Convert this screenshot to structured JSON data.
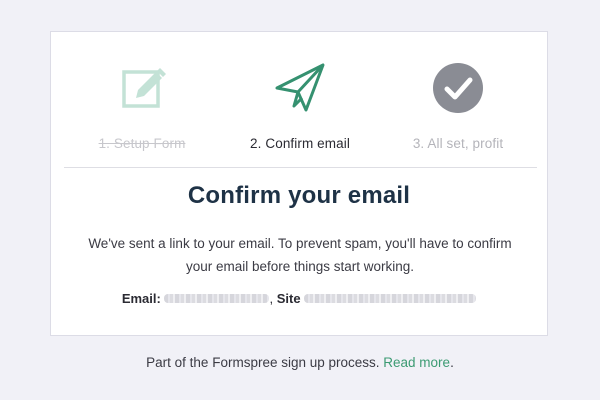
{
  "steps": [
    {
      "label": "1. Setup Form",
      "state": "completed",
      "icon": "edit-icon",
      "color": "#c3e2d6"
    },
    {
      "label": "2. Confirm email",
      "state": "active",
      "icon": "paper-plane-icon",
      "color": "#359170"
    },
    {
      "label": "3. All set, profit",
      "state": "pending",
      "icon": "checkmark-circle-icon",
      "color": "#8a8c94"
    }
  ],
  "confirm": {
    "title": "Confirm your email",
    "message": "We've sent a link to your email. To prevent spam, you'll have to confirm your email before things start working.",
    "email_label": "Email:",
    "site_label": "Site",
    "separator": ","
  },
  "footer": {
    "text": "Part of the Formspree sign up process.",
    "link_text": "Read more",
    "trailing": ".",
    "link_color": "#3c9b73"
  }
}
